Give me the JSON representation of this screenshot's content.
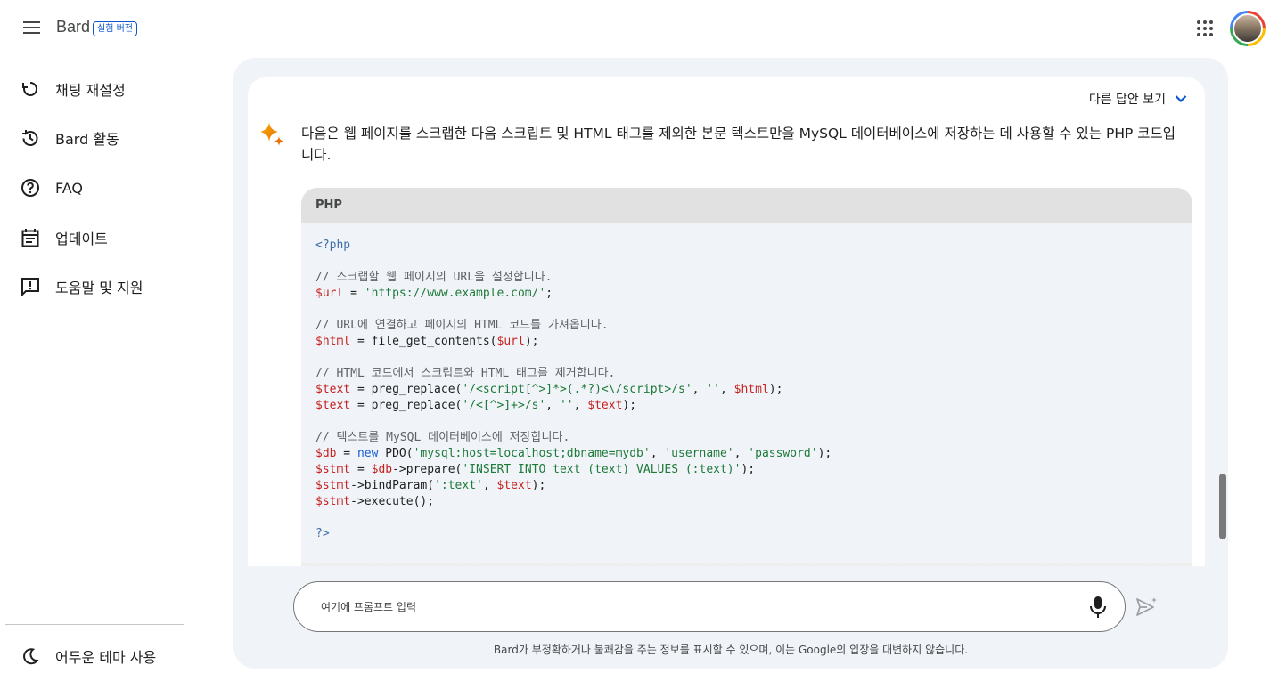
{
  "header": {
    "app_name": "Bard",
    "badge": "실험 버전",
    "icons": [
      "menu-icon",
      "apps-grid-icon",
      "account-avatar"
    ]
  },
  "sidebar": {
    "items": [
      {
        "label": "채팅 재설정",
        "icon": "reset-icon"
      },
      {
        "label": "Bard 활동",
        "icon": "history-icon"
      },
      {
        "label": "FAQ",
        "icon": "help-circle-icon"
      },
      {
        "label": "업데이트",
        "icon": "calendar-icon"
      },
      {
        "label": "도움말 및 지원",
        "icon": "feedback-icon"
      }
    ],
    "footer_item": {
      "label": "어두운 테마 사용",
      "icon": "moon-icon"
    }
  },
  "response": {
    "other_drafts_label": "다른 답안 보기",
    "intro_text": "다음은 웹 페이지를 스크랩한 다음 스크립트 및 HTML 태그를 제외한 본문 텍스트만을 MySQL 데이터베이스에 저장하는 데 사용할 수 있는 PHP 코드입니다.",
    "code_language": "PHP",
    "code": {
      "open_tag": "<?php",
      "c1": "// 스크랩할 웹 페이지의 URL을 설정합니다.",
      "l1_var": "$url",
      "l1_eq": " = ",
      "l1_str": "'https://www.example.com/'",
      "l1_end": ";",
      "c2": "// URL에 연결하고 페이지의 HTML 코드를 가져옵니다.",
      "l2_var": "$html",
      "l2_mid": " = file_get_contents(",
      "l2_arg": "$url",
      "l2_end": ");",
      "c3": "// HTML 코드에서 스크립트와 HTML 태그를 제거합니다.",
      "l3_var": "$text",
      "l3_mid": " = preg_replace(",
      "l3_s1": "'/<script[^>]*>(.*?)<\\/script>/s'",
      "l3_sep1": ", ",
      "l3_s2": "''",
      "l3_sep2": ", ",
      "l3_arg": "$html",
      "l3_end": ");",
      "l4_var": "$text",
      "l4_mid": " = preg_replace(",
      "l4_s1": "'/<[^>]+>/s'",
      "l4_sep1": ", ",
      "l4_s2": "''",
      "l4_sep2": ", ",
      "l4_arg": "$text",
      "l4_end": ");",
      "c4": "// 텍스트를 MySQL 데이터베이스에 저장합니다.",
      "l5_var": "$db",
      "l5_eq": " = ",
      "l5_kw": "new",
      "l5_mid": " PDO(",
      "l5_s1": "'mysql:host=localhost;dbname=mydb'",
      "l5_sep1": ", ",
      "l5_s2": "'username'",
      "l5_sep2": ", ",
      "l5_s3": "'password'",
      "l5_end": ");",
      "l6_var": "$stmt",
      "l6_eq": " = ",
      "l6_var2": "$db",
      "l6_mid": "->prepare(",
      "l6_s1": "'INSERT INTO text (text) VALUES (:text)'",
      "l6_end": ");",
      "l7_var": "$stmt",
      "l7_mid": "->bindParam(",
      "l7_s1": "':text'",
      "l7_sep": ", ",
      "l7_arg": "$text",
      "l7_end": ");",
      "l8_var": "$stmt",
      "l8_mid": "->execute();",
      "close_tag": "?>"
    }
  },
  "prompt": {
    "placeholder": "여기에 프롬프트 입력"
  },
  "disclaimer": "Bard가 부정확하거나 불쾌감을 주는 정보를 표시할 수 있으며, 이는 Google의 입장을 대변하지 않습니다.",
  "colors": {
    "accent": "#0b57d0",
    "panel_bg": "#f0f4f9",
    "code_header_bg": "#e1e1e1",
    "code_variable": "#c5221f",
    "code_string": "#1e7a38",
    "code_keyword": "#1a5bd6"
  }
}
